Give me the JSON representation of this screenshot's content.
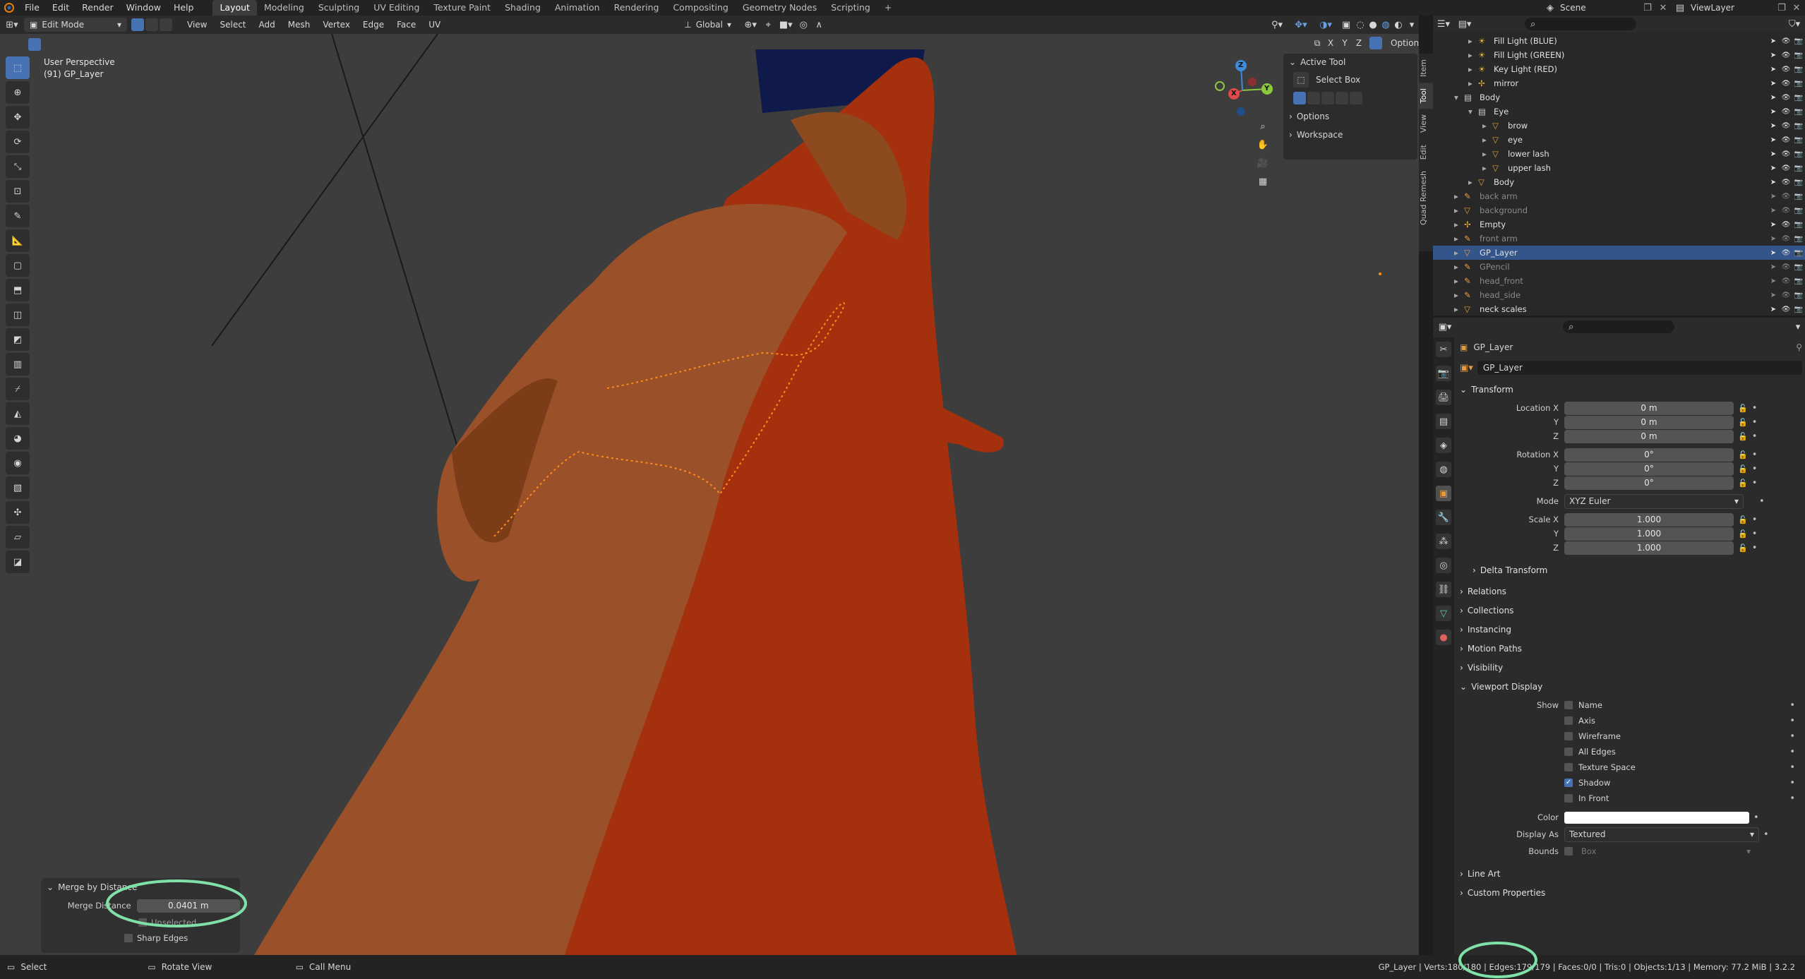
{
  "topbar": {
    "menus": [
      "File",
      "Edit",
      "Render",
      "Window",
      "Help"
    ],
    "workspaces": [
      "Layout",
      "Modeling",
      "Sculpting",
      "UV Editing",
      "Texture Paint",
      "Shading",
      "Animation",
      "Rendering",
      "Compositing",
      "Geometry Nodes",
      "Scripting"
    ],
    "active_workspace": "Layout",
    "scene": "Scene",
    "view_layer": "ViewLayer"
  },
  "viewport_header": {
    "mode": "Edit Mode",
    "menus": [
      "View",
      "Select",
      "Add",
      "Mesh",
      "Vertex",
      "Edge",
      "Face",
      "UV"
    ],
    "transform_orientation": "Global",
    "axis_x": "X",
    "axis_y": "Y",
    "axis_z": "Z",
    "options": "Options"
  },
  "viewport": {
    "perspective": "User Perspective",
    "object_info": "(91) GP_Layer"
  },
  "gizmo": {
    "x": "X",
    "y": "Y",
    "z": "Z"
  },
  "npanel": {
    "active_tool_header": "Active Tool",
    "tool_name": "Select Box",
    "options_label": "Options",
    "workspace_label": "Workspace",
    "tabs": [
      "Item",
      "Tool",
      "View",
      "Edit",
      "Quad Remesh"
    ]
  },
  "redo_panel": {
    "title": "Merge by Distance",
    "merge_distance_label": "Merge Distance",
    "merge_distance_value": "0.0401 m",
    "unselected_label": "Unselected",
    "sharp_edges_label": "Sharp Edges"
  },
  "outliner": {
    "items": [
      {
        "name": "Fill Light (BLUE)",
        "indent": 1,
        "kind": "light"
      },
      {
        "name": "Fill Light (GREEN)",
        "indent": 1,
        "kind": "light"
      },
      {
        "name": "Key Light (RED)",
        "indent": 1,
        "kind": "light"
      },
      {
        "name": "mirror",
        "indent": 1,
        "kind": "empty"
      },
      {
        "name": "Body",
        "indent": 0,
        "kind": "collection"
      },
      {
        "name": "Eye",
        "indent": 1,
        "kind": "collection"
      },
      {
        "name": "brow",
        "indent": 2,
        "kind": "mesh"
      },
      {
        "name": "eye",
        "indent": 2,
        "kind": "mesh"
      },
      {
        "name": "lower lash",
        "indent": 2,
        "kind": "mesh"
      },
      {
        "name": "upper lash",
        "indent": 2,
        "kind": "mesh"
      },
      {
        "name": "Body",
        "indent": 1,
        "kind": "mesh"
      },
      {
        "name": "back arm",
        "indent": 0,
        "kind": "gp",
        "dim": true
      },
      {
        "name": "background",
        "indent": 0,
        "kind": "mesh",
        "dim": true
      },
      {
        "name": "Empty",
        "indent": 0,
        "kind": "empty"
      },
      {
        "name": "front arm",
        "indent": 0,
        "kind": "gp",
        "dim": true
      },
      {
        "name": "GP_Layer",
        "indent": 0,
        "kind": "mesh",
        "selected": true
      },
      {
        "name": "GPencil",
        "indent": 0,
        "kind": "gp",
        "dim": true
      },
      {
        "name": "head_front",
        "indent": 0,
        "kind": "gp",
        "dim": true
      },
      {
        "name": "head_side",
        "indent": 0,
        "kind": "gp",
        "dim": true
      },
      {
        "name": "neck scales",
        "indent": 0,
        "kind": "mesh"
      }
    ]
  },
  "properties": {
    "object_name": "GP_Layer",
    "data_name": "GP_Layer",
    "transform_header": "Transform",
    "location_label": "Location X",
    "location": [
      "0 m",
      "0 m",
      "0 m"
    ],
    "rotation_label": "Rotation X",
    "rotation": [
      "0°",
      "0°",
      "0°"
    ],
    "mode_label": "Mode",
    "mode_value": "XYZ Euler",
    "scale_label": "Scale X",
    "scale": [
      "1.000",
      "1.000",
      "1.000"
    ],
    "y_label": "Y",
    "z_label": "Z",
    "delta_transform": "Delta Transform",
    "sections": [
      "Relations",
      "Collections",
      "Instancing",
      "Motion Paths",
      "Visibility"
    ],
    "viewport_display_header": "Viewport Display",
    "show_label": "Show",
    "show_items": [
      {
        "label": "Name",
        "checked": false
      },
      {
        "label": "Axis",
        "checked": false
      },
      {
        "label": "Wireframe",
        "checked": false
      },
      {
        "label": "All Edges",
        "checked": false
      },
      {
        "label": "Texture Space",
        "checked": false
      },
      {
        "label": "Shadow",
        "checked": true
      },
      {
        "label": "In Front",
        "checked": false
      }
    ],
    "color_label": "Color",
    "color_value": "#ffffff",
    "display_as_label": "Display As",
    "display_as_value": "Textured",
    "bounds_label": "Bounds",
    "bounds_value": "Box",
    "line_art": "Line Art",
    "custom_properties": "Custom Properties"
  },
  "status": {
    "select": "Select",
    "rotate_view": "Rotate View",
    "call_menu": "Call Menu",
    "stats": "GP_Layer | Verts:180/180 | Edges:179/179 | Faces:0/0 | Tris:0 | Objects:1/13 | Memory: 77.2 MiB | 3.2.2"
  },
  "colors": {
    "accent": "#4772b3",
    "selection": "#34558a",
    "vertex_selected": "#ff8c1a",
    "annotation_circle": "#7fe0a8"
  }
}
